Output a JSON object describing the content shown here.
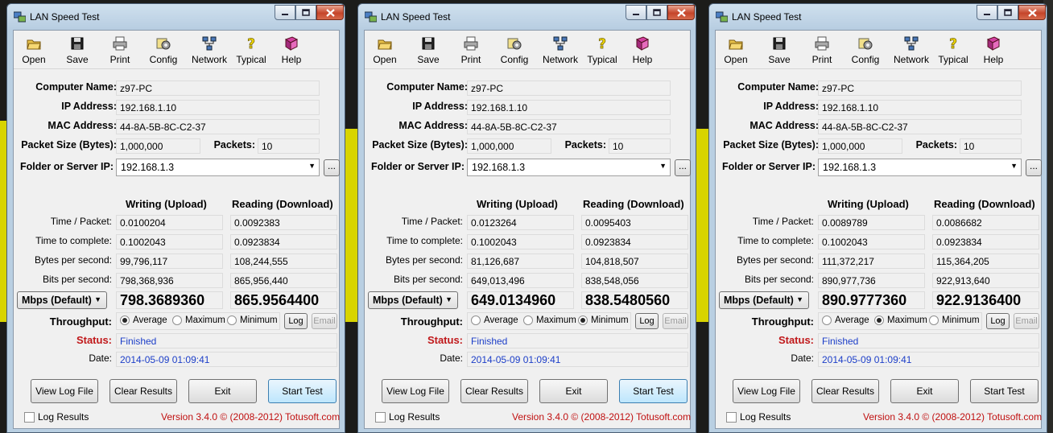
{
  "toolbar": [
    "Open",
    "Save",
    "Print",
    "Config",
    "Network",
    "Typical",
    "Help"
  ],
  "labels": {
    "computer_name": "Computer Name:",
    "ip_address": "IP Address:",
    "mac_address": "MAC Address:",
    "packet_size": "Packet Size (Bytes):",
    "packets": "Packets:",
    "folder": "Folder or Server IP:",
    "writing": "Writing (Upload)",
    "reading": "Reading (Download)",
    "time_packet": "Time / Packet:",
    "time_complete": "Time to complete:",
    "bytes_sec": "Bytes per second:",
    "bits_sec": "Bits per second:",
    "throughput": "Throughput:",
    "status": "Status:",
    "date": "Date:",
    "browse": "...",
    "average": "Average",
    "maximum": "Maximum",
    "minimum": "Minimum",
    "log": "Log",
    "email": "Email",
    "view_log": "View Log File",
    "clear": "Clear Results",
    "exit": "Exit",
    "start": "Start Test",
    "log_results": "Log Results",
    "version": "Version 3.4.0  © (2008-2012) Totusoft.com"
  },
  "windows": [
    {
      "title": "LAN Speed Test",
      "computer_name": "z97-PC",
      "ip": "192.168.1.10",
      "mac": "44-8A-5B-8C-C2-37",
      "packet_size": "1,000,000",
      "packets": "10",
      "server": "192.168.1.3",
      "w_time_packet": "0.0100204",
      "r_time_packet": "0.0092383",
      "w_time_complete": "0.1002043",
      "r_time_complete": "0.0923834",
      "w_bytes": "99,796,117",
      "r_bytes": "108,244,555",
      "w_bits": "798,368,936",
      "r_bits": "865,956,440",
      "unit": "Mbps (Default)",
      "w_mbps": "798.3689360",
      "r_mbps": "865.9564400",
      "throughput_mode": "Average",
      "status": "Finished",
      "date": "2014-05-09 01:09:41",
      "focused_button": "Start Test"
    },
    {
      "title": "LAN Speed Test",
      "computer_name": "z97-PC",
      "ip": "192.168.1.10",
      "mac": "44-8A-5B-8C-C2-37",
      "packet_size": "1,000,000",
      "packets": "10",
      "server": "192.168.1.3",
      "w_time_packet": "0.0123264",
      "r_time_packet": "0.0095403",
      "w_time_complete": "0.1002043",
      "r_time_complete": "0.0923834",
      "w_bytes": "81,126,687",
      "r_bytes": "104,818,507",
      "w_bits": "649,013,496",
      "r_bits": "838,548,056",
      "unit": "Mbps (Default)",
      "w_mbps": "649.0134960",
      "r_mbps": "838.5480560",
      "throughput_mode": "Minimum",
      "status": "Finished",
      "date": "2014-05-09 01:09:41",
      "focused_button": "Start Test"
    },
    {
      "title": "LAN Speed Test",
      "computer_name": "z97-PC",
      "ip": "192.168.1.10",
      "mac": "44-8A-5B-8C-C2-37",
      "packet_size": "1,000,000",
      "packets": "10",
      "server": "192.168.1.3",
      "w_time_packet": "0.0089789",
      "r_time_packet": "0.0086682",
      "w_time_complete": "0.1002043",
      "r_time_complete": "0.0923834",
      "w_bytes": "111,372,217",
      "r_bytes": "115,364,205",
      "w_bits": "890,977,736",
      "r_bits": "922,913,640",
      "unit": "Mbps (Default)",
      "w_mbps": "890.9777360",
      "r_mbps": "922.9136400",
      "throughput_mode": "Maximum",
      "status": "Finished",
      "date": "2014-05-09 01:09:41",
      "focused_button": "None"
    }
  ],
  "colors": {
    "status_label": "#c0181a",
    "status_value": "#1c3ec8",
    "date_value": "#1c3ec8",
    "version": "#c01010",
    "background_accent": "#e8e000"
  }
}
